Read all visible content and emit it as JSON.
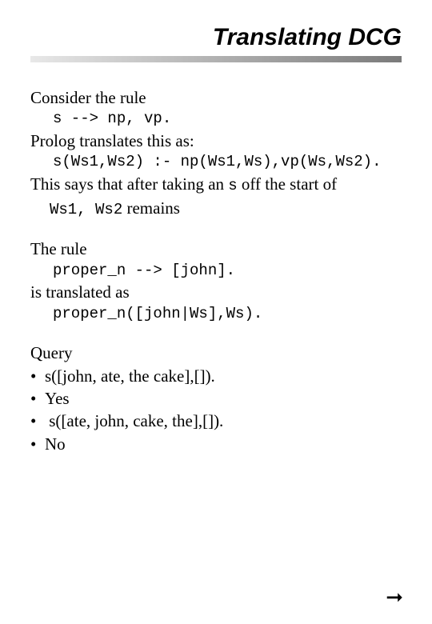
{
  "title": "Translating DCG",
  "p1": "Consider the rule",
  "code1": "s --> np, vp.",
  "p2": "Prolog translates this as:",
  "code2": "s(Ws1,Ws2) :- np(Ws1,Ws),vp(Ws,Ws2).",
  "p3a": "This says that after taking an ",
  "p3code": "s",
  "p3b": " off the start of ",
  "p3c_code1": "Ws1, Ws2",
  "p3c_tail": " remains",
  "p4": "The rule",
  "code3": "proper_n --> [john].",
  "p5": "is translated as",
  "code4": "proper_n([john|Ws],Ws).",
  "p6": "Query",
  "b1": "s([john, ate, the cake],[]).",
  "b2": "Yes",
  "b3": " s([ate, john, cake, the],[]).",
  "b4": "No",
  "arrow": "➞"
}
